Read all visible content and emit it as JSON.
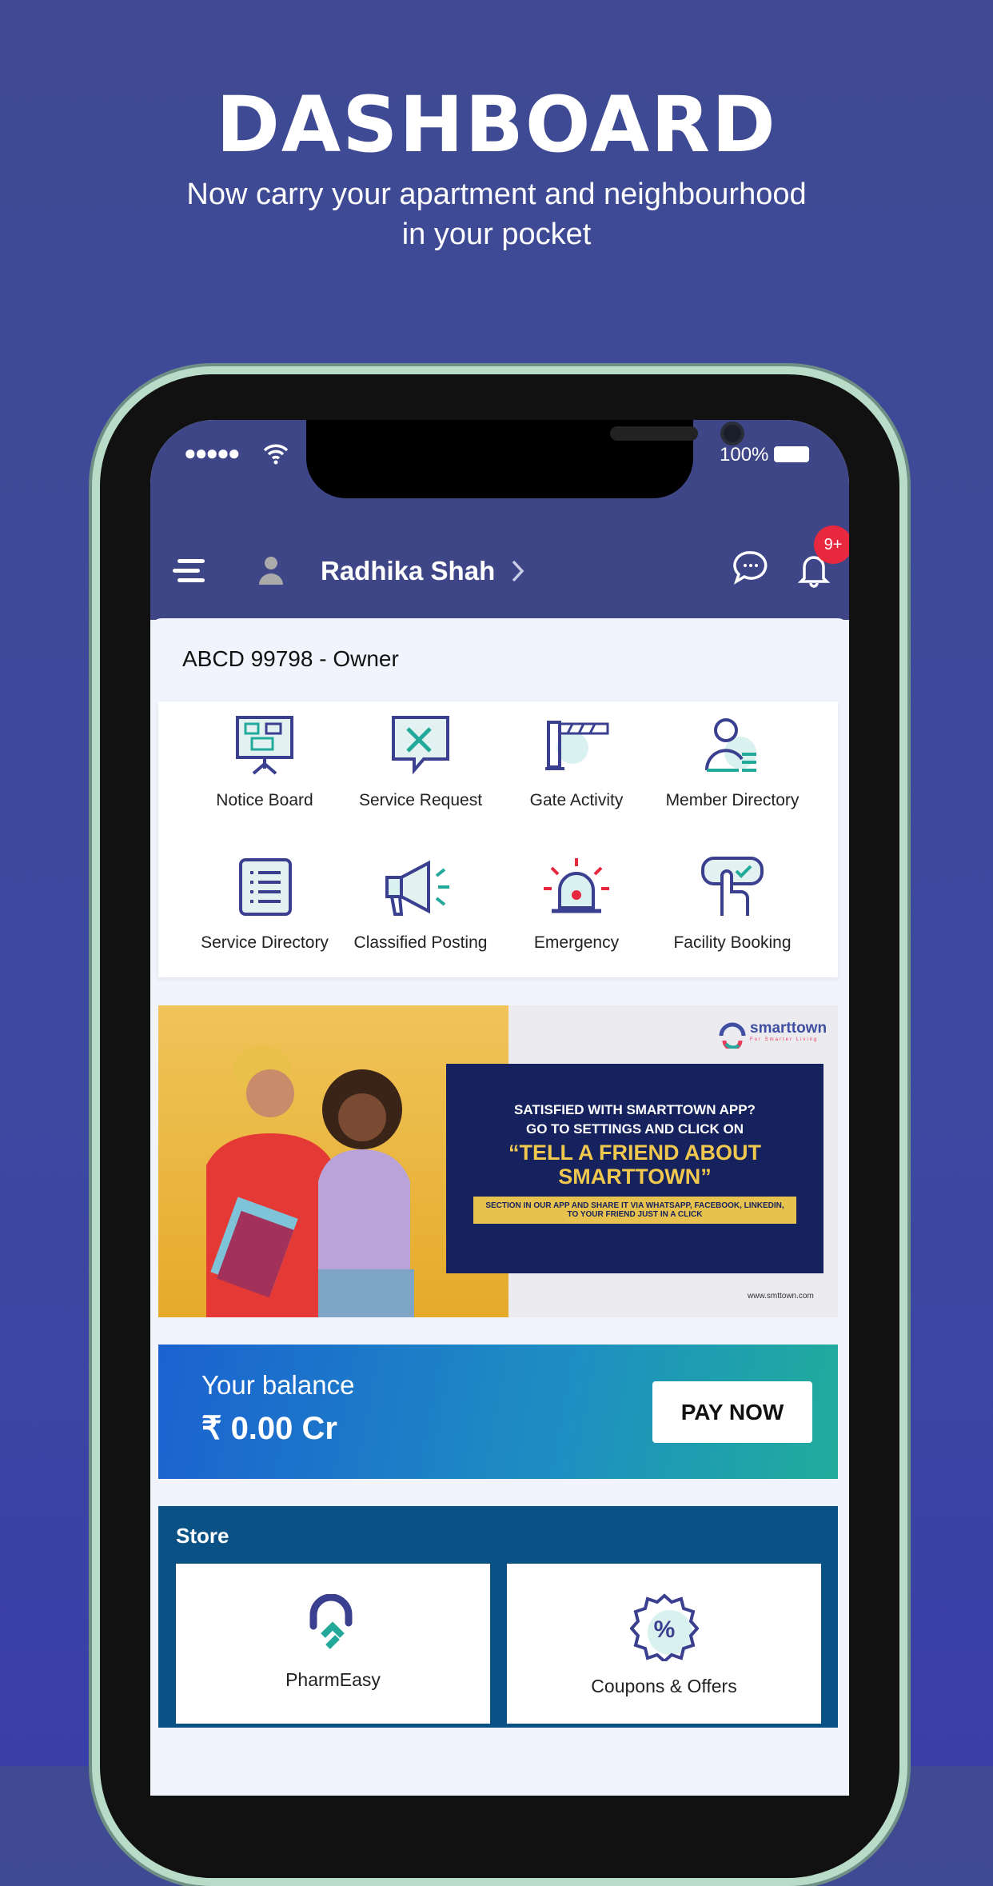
{
  "hero": {
    "title": "DASHBOARD",
    "subtitle_line1": "Now carry your apartment and neighbourhood",
    "subtitle_line2": "in your pocket"
  },
  "status_bar": {
    "battery": "100%"
  },
  "header": {
    "user_name": "Radhika Shah",
    "notification_badge": "9+"
  },
  "unit": "ABCD 99798 - Owner",
  "features": [
    {
      "label": "Notice Board",
      "icon": "notice-board-icon"
    },
    {
      "label": "Service Request",
      "icon": "service-request-icon"
    },
    {
      "label": "Gate Activity",
      "icon": "gate-icon"
    },
    {
      "label": "Member Directory",
      "icon": "member-directory-icon"
    },
    {
      "label": "Service Directory",
      "icon": "service-directory-icon"
    },
    {
      "label": "Classified Posting",
      "icon": "megaphone-icon"
    },
    {
      "label": "Emergency",
      "icon": "siren-icon"
    },
    {
      "label": "Facility Booking",
      "icon": "facility-booking-icon"
    }
  ],
  "banner": {
    "brand": "smarttown",
    "tagline": "For Smarter Living",
    "line1": "SATISFIED WITH SMARTTOWN APP?",
    "line2": "GO TO SETTINGS AND CLICK ON",
    "highlight": "“TELL A FRIEND ABOUT SMARTTOWN”",
    "note": "SECTION IN OUR APP AND SHARE IT VIA WHATSAPP, FACEBOOK, LINKEDIN, TO YOUR FRIEND JUST IN A CLICK",
    "url": "www.smttown.com"
  },
  "balance": {
    "label": "Your balance",
    "amount": "₹ 0.00 Cr",
    "pay_label": "PAY NOW"
  },
  "store": {
    "title": "Store",
    "items": [
      {
        "label": "PharmEasy"
      },
      {
        "label": "Coupons & Offers"
      }
    ]
  },
  "colors": {
    "header": "#3f4687",
    "accent": "#3b3f8f",
    "badge": "#e8283f",
    "store": "#0a5286"
  }
}
